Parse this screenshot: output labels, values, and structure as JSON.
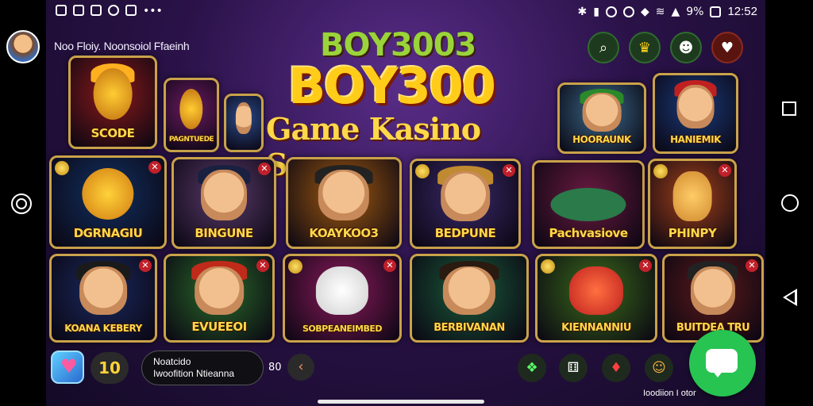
{
  "status_bar": {
    "time": "12:52",
    "battery": "9%"
  },
  "app": {
    "title": "Noo Floiy. Noonsoiol Ffaeinh"
  },
  "logo": {
    "line1": "BOY3003",
    "line2": "BOY300",
    "tagline": "Game Kasino Seru"
  },
  "top_icons": [
    "search-icon",
    "crown-icon",
    "dog-icon",
    "chat-icon"
  ],
  "games": [
    {
      "label": "SCODE",
      "color": "#8a1a1a"
    },
    {
      "label": "PAGNTUEDE",
      "color": "#6a1a60"
    },
    {
      "label": "",
      "color": "#2a4a8a"
    },
    {
      "label": "HOORAUNK",
      "color": "#3a6a8a"
    },
    {
      "label": "HANIEMIK",
      "color": "#1a3a7a"
    },
    {
      "label": "DGRNAGIU",
      "color": "#123060"
    },
    {
      "label": "BINGUNE",
      "color": "#5a3a6a"
    },
    {
      "label": "KOAYKOO3",
      "color": "#a05a10"
    },
    {
      "label": "BEDPUNE",
      "color": "#3a2a6a"
    },
    {
      "label": "Pachvasiove",
      "color": "#6a1a40"
    },
    {
      "label": "PHINPY",
      "color": "#a0401a"
    },
    {
      "label": "KOANA KEBERY",
      "color": "#1a2a60"
    },
    {
      "label": "EVUEEOI",
      "color": "#2a6a2a"
    },
    {
      "label": "SOBPEANEIMBED",
      "color": "#8a1a5a"
    },
    {
      "label": "BERBIVANAN",
      "color": "#1a5a3a"
    },
    {
      "label": "KIENNANNIU",
      "color": "#3a6a1a"
    },
    {
      "label": "BUITDEA TRU",
      "color": "#5a1a1a"
    }
  ],
  "bottom": {
    "level": "10",
    "message_line1": "Noatcido",
    "message_line2": "Iwoofition Ntieanna",
    "value": "80",
    "caption": "Ioodiion I otor"
  },
  "bottom_icons": [
    "gift-icon",
    "dice-icon",
    "candy-icon",
    "lion-icon"
  ]
}
